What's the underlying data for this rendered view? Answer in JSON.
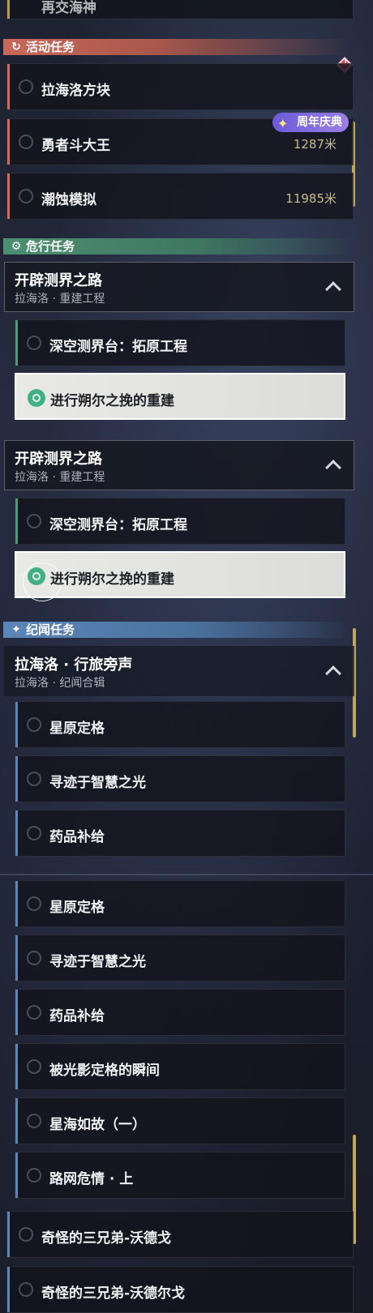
{
  "top_partial": {
    "label": "再交海神"
  },
  "categories": {
    "event": {
      "label": "活动任务",
      "icon": "event-refresh-icon",
      "color": "#d06a5c"
    },
    "danger": {
      "label": "危行任务",
      "icon": "gear-badge-icon",
      "color": "#4f9a7a"
    },
    "chronicle": {
      "label": "纪闻任务",
      "icon": "sparkle-icon",
      "color": "#5a86b8"
    }
  },
  "event_quests": [
    {
      "label": "拉海洛方块",
      "distance": ""
    },
    {
      "label": "勇者斗大王",
      "distance": "1287米"
    },
    {
      "label": "潮蚀模拟",
      "distance": "11985米"
    }
  ],
  "anniversary_badge": {
    "text": "周年庆典"
  },
  "danger_groups": [
    {
      "title": "开辟测界之路",
      "subtitle": "拉海洛 · 重建工程",
      "items": [
        {
          "label": "深空测界台：拓原工程",
          "active": false
        },
        {
          "label": "进行朔尔之挽的重建",
          "active": true
        }
      ]
    },
    {
      "title": "开辟测界之路",
      "subtitle": "拉海洛 · 重建工程",
      "items": [
        {
          "label": "深空测界台：拓原工程",
          "active": false
        },
        {
          "label": "进行朔尔之挽的重建",
          "active": true
        }
      ]
    }
  ],
  "chronicle_group": {
    "title": "拉海洛 · 行旅旁声",
    "subtitle": "拉海洛 · 纪闻合辑",
    "items_a": [
      "星原定格",
      "寻迹于智慧之光",
      "药品补给"
    ],
    "items_b": [
      "星原定格",
      "寻迹于智慧之光",
      "药品补给",
      "被光影定格的瞬间",
      "星海如故（一）",
      "路网危情 · 上"
    ]
  },
  "bottom_quests": [
    "奇怪的三兄弟-沃德戈",
    "奇怪的三兄弟-沃德尔戈"
  ],
  "colors": {
    "event_accent": "#d06a5c",
    "danger_accent": "#4f9a7a",
    "chronicle_accent": "#5a86b8",
    "gold": "#bfa75a"
  }
}
